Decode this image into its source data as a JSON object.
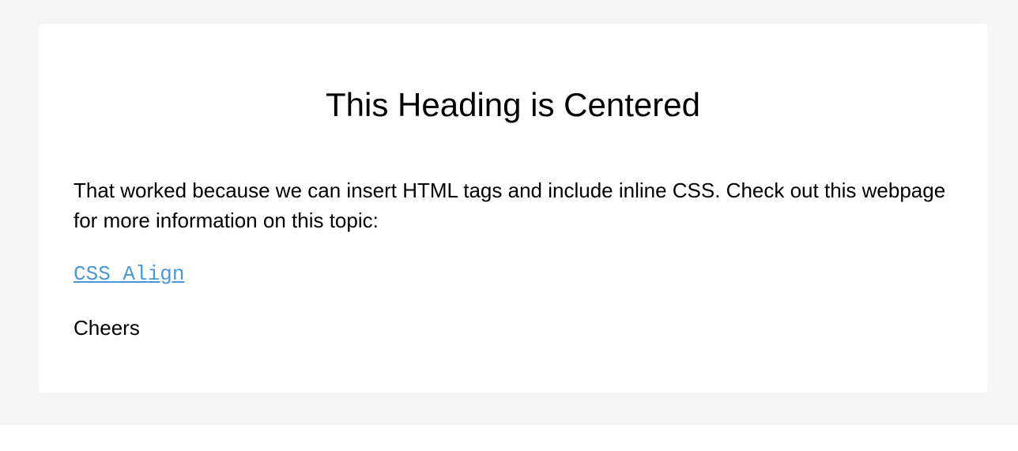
{
  "colors": {
    "page_background": "#f5f5f5",
    "card_background": "#ffffff",
    "text": "#000000",
    "link": "#4a97d6"
  },
  "content": {
    "heading": "This Heading is Centered",
    "paragraph": "That worked because we can insert HTML tags and include inline CSS. Check out this webpage for more information on this topic:",
    "link_text": "CSS Align",
    "signoff": "Cheers"
  }
}
